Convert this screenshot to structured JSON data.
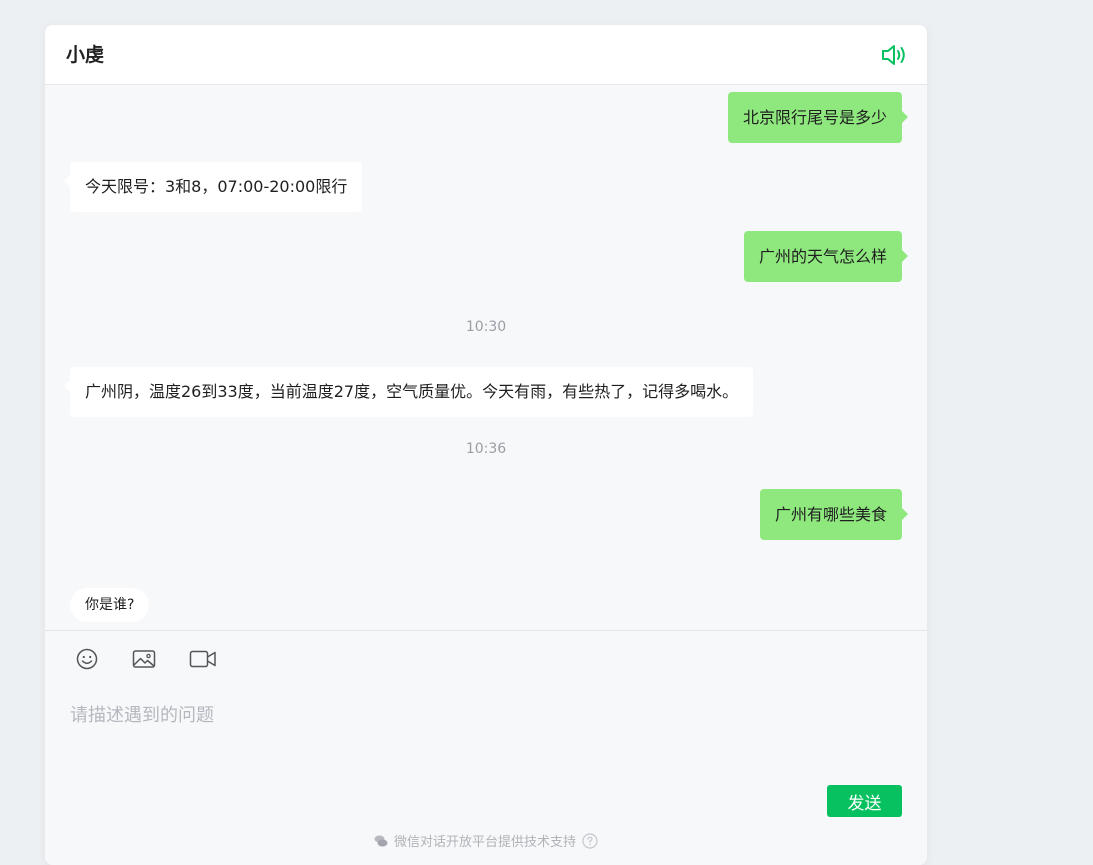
{
  "header": {
    "title": "小虔",
    "speaker_icon": "speaker-icon",
    "accent_color": "#07c160"
  },
  "messages": [
    {
      "role": "user",
      "text": "北京限行尾号是多少"
    },
    {
      "role": "bot",
      "text": "今天限号：3和8，07:00-20:00限行"
    },
    {
      "role": "user",
      "text": "广州的天气怎么样"
    },
    {
      "role": "time",
      "text": "10:30"
    },
    {
      "role": "bot",
      "text": "广州阴，温度26到33度，当前温度27度，空气质量优。今天有雨，有些热了，记得多喝水。"
    },
    {
      "role": "time",
      "text": "10:36"
    },
    {
      "role": "user",
      "text": "广州有哪些美食"
    }
  ],
  "suggestion": {
    "text": "你是谁?"
  },
  "toolbar": {
    "emoji_icon": "emoji-icon",
    "image_icon": "image-icon",
    "video_icon": "video-icon"
  },
  "input": {
    "placeholder": "请描述遇到的问题",
    "value": ""
  },
  "send_label": "发送",
  "footer_text": "微信对话开放平台提供技术支持",
  "colors": {
    "user_bubble": "#8ee87e",
    "bot_bubble": "#ffffff",
    "send_button": "#07c160"
  }
}
